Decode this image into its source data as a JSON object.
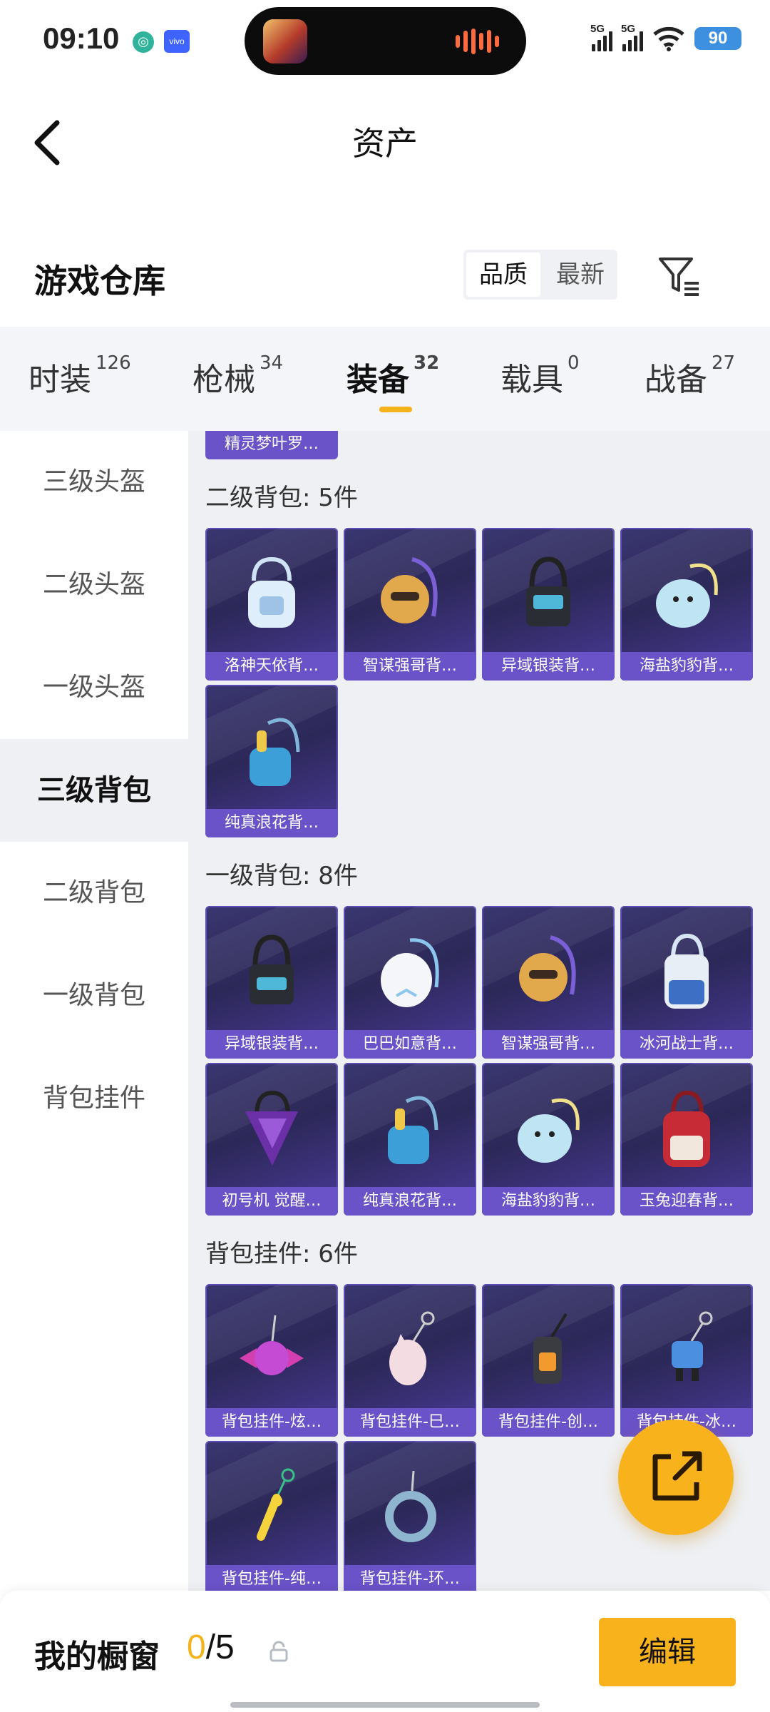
{
  "status_bar": {
    "time": "09:10",
    "battery": "90",
    "net1": "5G",
    "net2": "5G"
  },
  "nav": {
    "title": "资产"
  },
  "warehouse": {
    "title": "游戏仓库",
    "sort_options": [
      "品质",
      "最新"
    ]
  },
  "tabs": [
    {
      "label": "时装",
      "count": "126"
    },
    {
      "label": "枪械",
      "count": "34"
    },
    {
      "label": "装备",
      "count": "32"
    },
    {
      "label": "载具",
      "count": "0"
    },
    {
      "label": "战备",
      "count": "27"
    }
  ],
  "sidebar": {
    "items": [
      "三级头盔",
      "二级头盔",
      "一级头盔",
      "三级背包",
      "二级背包",
      "一级背包",
      "背包挂件"
    ],
    "active_index": 3
  },
  "content": {
    "partial_item": "精灵梦叶罗…",
    "sections": [
      {
        "title": "二级背包: 5件",
        "items": [
          "洛神天依背…",
          "智谋强哥背…",
          "异域银装背…",
          "海盐豹豹背…",
          "纯真浪花背…"
        ]
      },
      {
        "title": "一级背包: 8件",
        "items": [
          "异域银装背…",
          "巴巴如意背…",
          "智谋强哥背…",
          "冰河战士背…",
          "初号机 觉醒…",
          "纯真浪花背…",
          "海盐豹豹背…",
          "玉兔迎春背…"
        ]
      },
      {
        "title": "背包挂件: 6件",
        "items": [
          "背包挂件-炫…",
          "背包挂件-巳…",
          "背包挂件-创…",
          "背包挂件-冰…",
          "背包挂件-纯…",
          "背包挂件-环…"
        ]
      }
    ]
  },
  "bottom_bar": {
    "label": "我的橱窗",
    "current": "0",
    "separator": "/",
    "total": "5",
    "edit_label": "编辑"
  },
  "colors": {
    "accent": "#f8b21b",
    "card_bg": "#2c2858",
    "card_label": "#6a52c8"
  }
}
